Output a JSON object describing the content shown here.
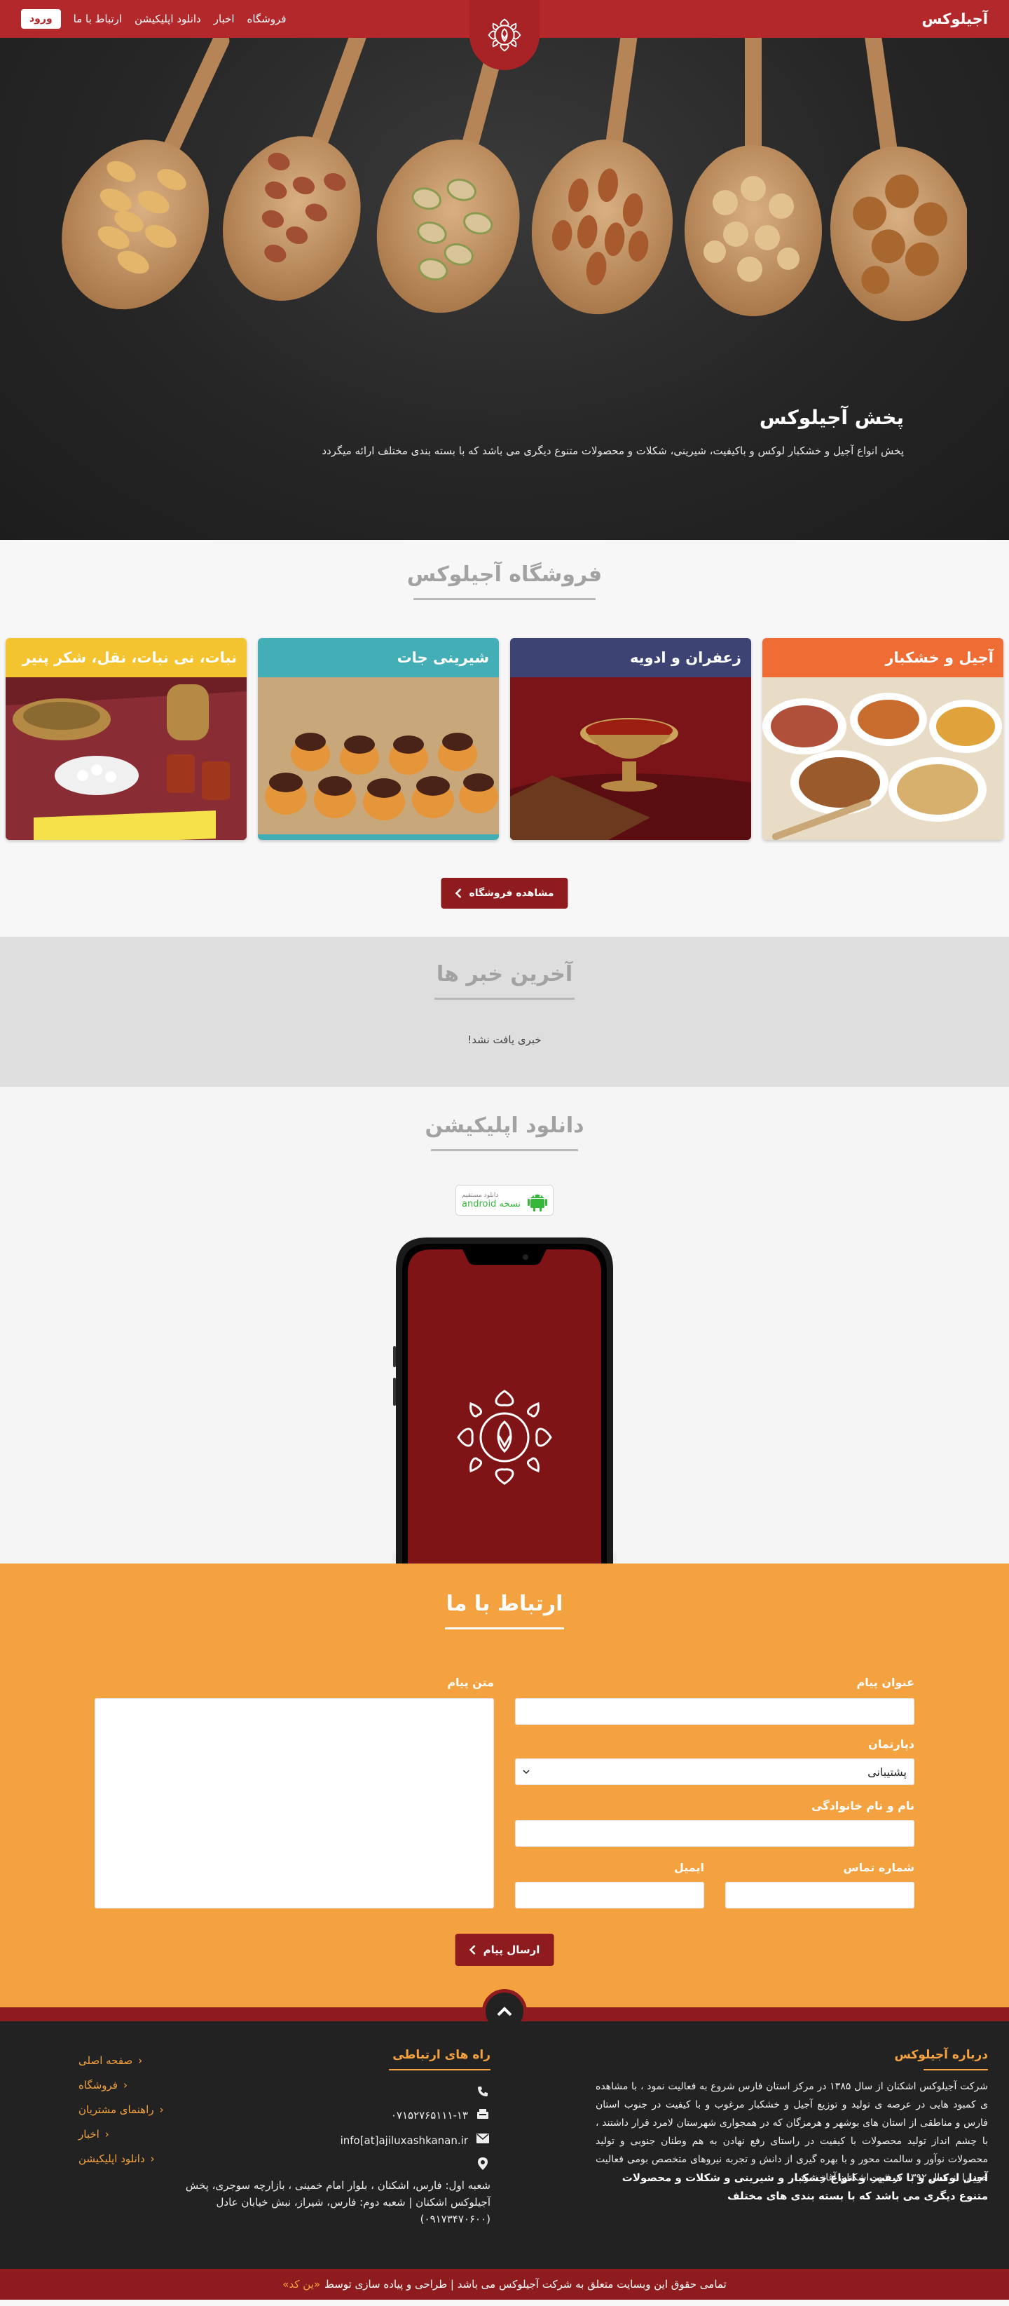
{
  "nav": {
    "brand": "آجیلوکس",
    "links": [
      "فروشگاه",
      "اخبار",
      "دانلود اپلیکیشن",
      "ارتباط با ما"
    ],
    "login": "ورود"
  },
  "hero": {
    "title": "پخش آجیلوکس",
    "description": "پخش انواع آجیل و خشکبار لوکس و باکیفیت، شیرینی، شکلات و محصولات متنوع دیگری می باشد که با بسته بندی مختلف ارائه میگردد"
  },
  "shop": {
    "title": "فروشگاه آجیلوکس",
    "categories": [
      {
        "label": "آجیل و خشکبار",
        "color": "#ef6c35"
      },
      {
        "label": "زعفران و ادویه",
        "color": "#3d4473"
      },
      {
        "label": "شیرینی جات",
        "color": "#43aeb5"
      },
      {
        "label": "نبات، نی نبات، نقل، شکر پنیر",
        "color": "#f4c430"
      }
    ],
    "button": "مشاهده فروشگاه"
  },
  "news": {
    "title": "آخرین خبر ها",
    "empty": "خبری یافت نشد!"
  },
  "app": {
    "title": "دانلود اپلیکیشن",
    "badge_small": "دانلود مستقیم",
    "badge_main": "نسخه android"
  },
  "contact": {
    "title": "ارتباط با ما",
    "subject_label": "عنوان پیام",
    "department_label": "دپارتمان",
    "department_value": "پشتیبانی",
    "name_label": "نام و نام خانوادگی",
    "phone_label": "شماره تماس",
    "email_label": "ایمیل",
    "message_label": "متن پیام",
    "submit": "ارسال پیام"
  },
  "footer": {
    "about_title": "درباره آجیلوکس",
    "about_text": "شرکت آجیلوکس اشکنان از سال ۱۳۸۵ در مرکز استان فارس شروع به فعالیت نمود ، با مشاهده ی کمبود هایی در عرصه ی تولید و توزیع آجیل و خشکبار مرغوب و با کیفیت در جنوب استان فارس و مناطقی از استان های بوشهر و هرمزگان که در همجواری شهرستان لامرد قرار داشتند ، با چشم انداز تولید محصولات با کیفیت در راستای رفع نهادن به هم وطنان جنوبی و تولید محصولات نوآور و سالمت محور و با بهره گیری از دانش و تجربه نیروهای متخصص بومی فعالیت خود را از سال ۱۳۹۲ در شهر اشکنان آغاز نمود .",
    "about_strong": "آجیل لوکس و با کیفیت و انواع خشکبار و شیرینی و شکلات و محصولات متنوع دیگری می باشد که با بسته بندی های مختلف",
    "contact_title": "راه های ارتباطی",
    "phone": "۰۷۱۵۲۷۶۵۱۱۱-۱۳",
    "email": "info[at]ajiluxashkanan.ir",
    "address": "شعبه اول: فارس، اشکنان ، بلوار امام خمینی ، بازارچه سوجری، پخش آجیلوکس اشکنان | شعبه دوم: فارس، شیراز، نبش خیابان عادل (۰۹۱۷۳۴۷۰۶۰۰)",
    "links": [
      "صفحه اصلی",
      "فروشگاه",
      "راهنمای مشتریان",
      "اخبار",
      "دانلود اپلیکیشن"
    ],
    "copyright": "تمامی حقوق این وبسایت متعلق به شرکت آجیلوکس می باشد | طراحی و پیاده سازی توسط",
    "copyright_link": "«ین کد»"
  },
  "colors": {
    "brand_red": "#b2282b",
    "dark_red": "#8e1c1e",
    "orange": "#f4a240",
    "footer_bg": "#222222"
  },
  "icons": [
    "emblem-icon",
    "chevron-left-icon",
    "android-icon",
    "chevron-up-icon",
    "phone-icon",
    "fax-icon",
    "mail-icon",
    "map-pin-icon"
  ]
}
